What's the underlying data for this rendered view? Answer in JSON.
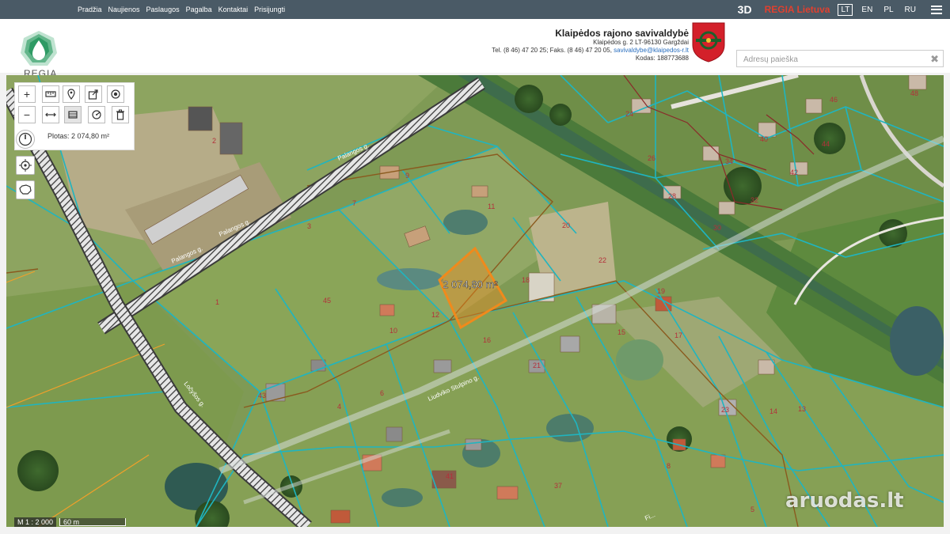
{
  "topnav": {
    "items": [
      "Pradžia",
      "Naujienos",
      "Paslaugos",
      "Pagalba",
      "Kontaktai",
      "Prisijungti"
    ],
    "btn3d": "3D",
    "regia": "REGIA Lietuva",
    "languages": [
      "LT",
      "EN",
      "PL",
      "RU"
    ],
    "active_language": "LT"
  },
  "header": {
    "logo_text": "REGIA",
    "municipality": {
      "title": "Klaipėdos rajono savivaldybė",
      "address": "Klaipėdos g. 2 LT-96130 Gargždai",
      "phone_prefix": "Tel. (8 46) 47 20 25; Faks. (8 46) 47 20 05, ",
      "email": "savivaldybe@klaipedos-r.lt",
      "code": "Kodas: 188773688"
    },
    "search": {
      "placeholder": "Adresų paieška",
      "value": ""
    }
  },
  "map": {
    "measure_label": "2 074,80 m²",
    "area_readout": "Plotas: 2 074,80 m²",
    "scale_ratio": "M 1 : 2 000",
    "scale_bar": "60 m",
    "watermark": "aruodas.lt",
    "streets": [
      "Palangos g.",
      "Palangos g.",
      "Palangos g.",
      "Ločyšos g.",
      "Liudviko Stulpino g.",
      "Fi..."
    ],
    "parcel_numbers": [
      "1",
      "2",
      "3",
      "4",
      "5",
      "6",
      "7",
      "8",
      "9",
      "10",
      "11",
      "12",
      "13",
      "14",
      "15",
      "16",
      "17",
      "18",
      "19",
      "20",
      "21",
      "22",
      "23",
      "24",
      "26",
      "28",
      "30",
      "32",
      "34",
      "37",
      "40",
      "41",
      "42",
      "43",
      "44",
      "45",
      "46",
      "48"
    ],
    "colors": {
      "parcel_line": "#1fb5c0",
      "selection": "#f08a1c",
      "road": "#3a3a3a",
      "boundary": "#8a5a1e"
    }
  },
  "tools": {
    "zoom_in": "+",
    "zoom_out": "−"
  }
}
